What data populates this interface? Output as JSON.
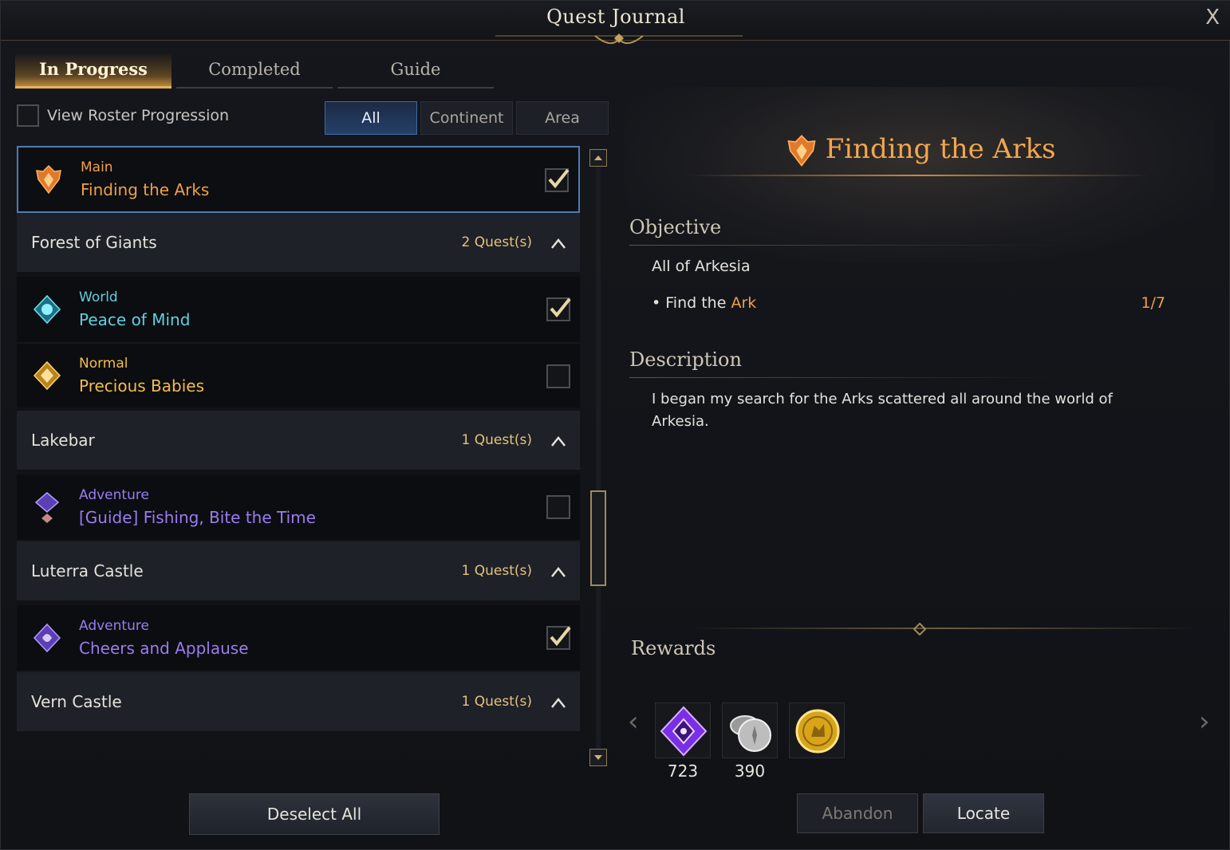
{
  "window": {
    "title": "Quest Journal",
    "close_label": "X"
  },
  "tabs": [
    {
      "label": "In Progress",
      "active": true
    },
    {
      "label": "Completed",
      "active": false
    },
    {
      "label": "Guide",
      "active": false
    }
  ],
  "roster": {
    "label": "View Roster Progression",
    "checked": false
  },
  "filters": [
    {
      "label": "All",
      "active": true
    },
    {
      "label": "Continent",
      "active": false
    },
    {
      "label": "Area",
      "active": false
    }
  ],
  "list": {
    "main_quest": {
      "type": "Main",
      "name": "Finding the Arks",
      "checked": true,
      "icon": "main-quest-icon"
    },
    "groups": [
      {
        "name": "Forest of Giants",
        "count": "2 Quest(s)",
        "quests": [
          {
            "type": "World",
            "name": "Peace of Mind",
            "checked": true,
            "icon": "world-quest-icon"
          },
          {
            "type": "Normal",
            "name": "Precious Babies",
            "checked": false,
            "icon": "normal-quest-icon"
          }
        ]
      },
      {
        "name": "Lakebar",
        "count": "1 Quest(s)",
        "quests": [
          {
            "type": "Adventure",
            "name": "[Guide] Fishing, Bite the Time",
            "checked": false,
            "icon": "adventure-quest-icon"
          }
        ]
      },
      {
        "name": "Luterra Castle",
        "count": "1 Quest(s)",
        "quests": [
          {
            "type": "Adventure",
            "name": "Cheers and Applause",
            "checked": true,
            "icon": "adventure-quest-icon"
          }
        ]
      },
      {
        "name": "Vern Castle",
        "count": "1 Quest(s)",
        "quests": []
      }
    ]
  },
  "deselect_label": "Deselect All",
  "detail": {
    "title": "Finding the Arks",
    "objective_heading": "Objective",
    "objective_area": "All of Arkesia",
    "objective_task_prefix": "Find the ",
    "objective_task_highlight": "Ark",
    "objective_progress": "1/7",
    "description_heading": "Description",
    "description": "I began my search for the Arks scattered all around the world of Arkesia.",
    "rewards_heading": "Rewards",
    "rewards": [
      {
        "icon": "purple-crystal-icon",
        "count": "723"
      },
      {
        "icon": "silver-coins-icon",
        "count": "390"
      },
      {
        "icon": "gold-medal-icon",
        "count": ""
      }
    ]
  },
  "actions": {
    "abandon_label": "Abandon",
    "locate_label": "Locate"
  },
  "colors": {
    "main": "#f0a049",
    "world": "#5fd1e0",
    "normal": "#f2bd4a",
    "adventure": "#9a7cf2",
    "accent_blue": "#4f7bb3"
  }
}
